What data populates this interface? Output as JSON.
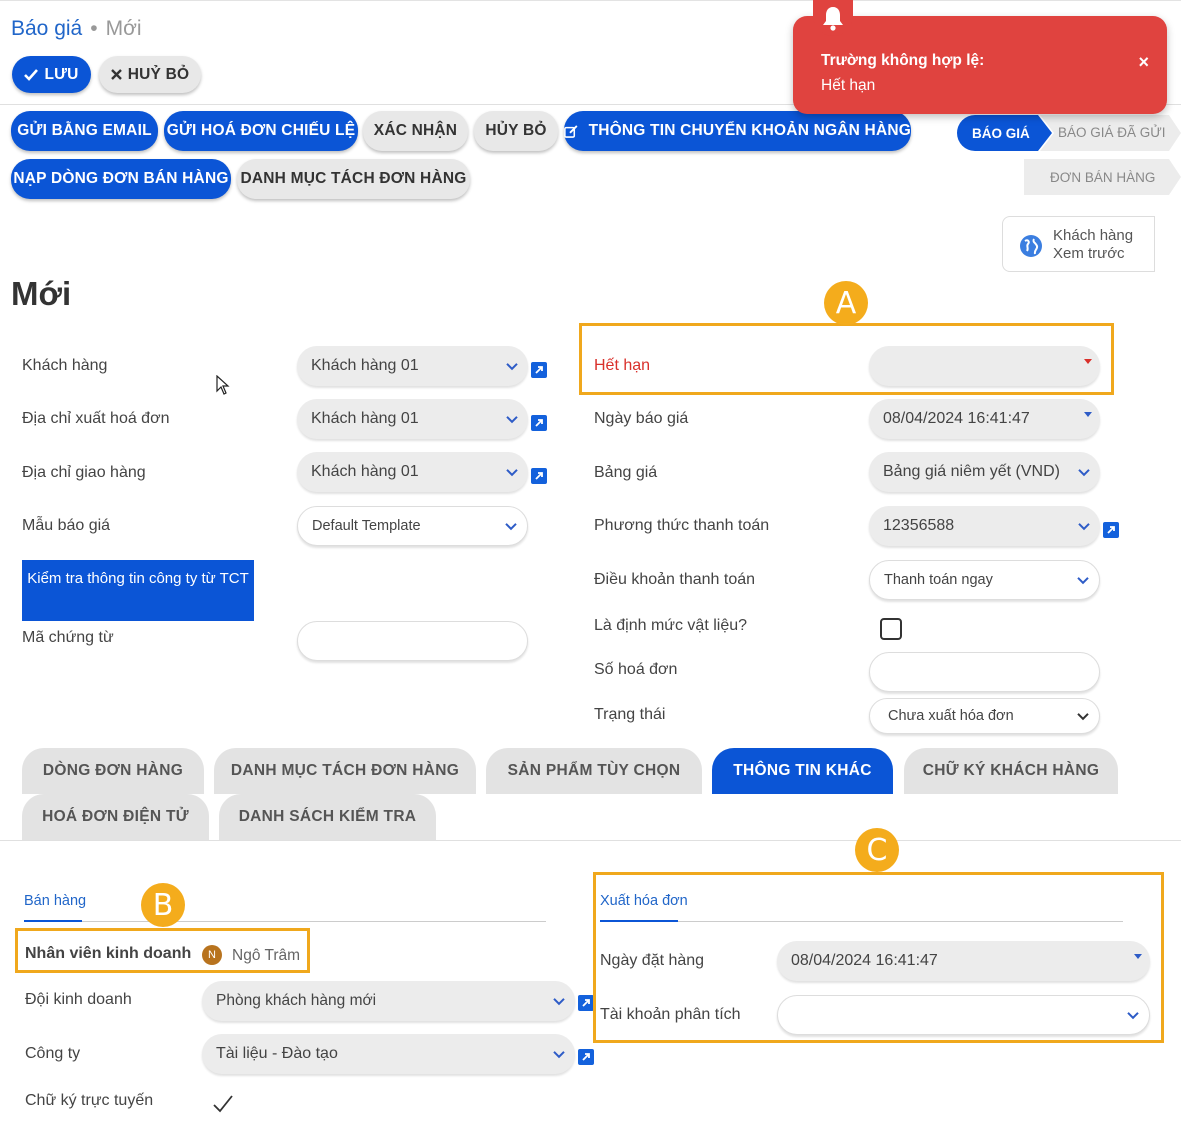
{
  "breadcrumb": {
    "parent": "Báo giá",
    "current": "Mới"
  },
  "toolbar": {
    "save_label": "LƯU",
    "discard_label": "HUỶ BỎ"
  },
  "actions": [
    "GỬI BẰNG EMAIL",
    "GỬI HOÁ ĐƠN CHIẾU LỆ",
    "XÁC NHẬN",
    "HỦY BỎ",
    "THÔNG TIN CHUYỂN KHOẢN NGÂN HÀNG",
    "NẠP DÒNG ĐƠN BÁN HÀNG",
    "DANH MỤC TÁCH ĐƠN HÀNG"
  ],
  "status_steps": [
    "BÁO GIÁ",
    "BÁO GIÁ ĐÃ GỬI",
    "ĐƠN BÁN HÀNG"
  ],
  "toast": {
    "title": "Trường không hợp lệ:",
    "message": "Hết hạn",
    "close": "×"
  },
  "preview": {
    "line1": "Khách hàng",
    "line2": "Xem trước"
  },
  "record_title": "Mới",
  "left_fields": {
    "customer": {
      "label": "Khách hàng",
      "value": "Khách hàng 01"
    },
    "invoice_address": {
      "label": "Địa chỉ xuất hoá đơn",
      "value": "Khách hàng 01"
    },
    "delivery_address": {
      "label": "Địa chỉ giao hàng",
      "value": "Khách hàng 01"
    },
    "template": {
      "label": "Mẫu báo giá",
      "value": "Default Template"
    },
    "check_button": "Kiểm tra thông tin công ty từ TCT",
    "doc_code": {
      "label": "Mã chứng từ",
      "value": ""
    }
  },
  "right_fields": {
    "expiry": {
      "label": "Hết hạn",
      "value": ""
    },
    "quote_date": {
      "label": "Ngày báo giá",
      "value": "08/04/2024 16:41:47"
    },
    "pricelist": {
      "label": "Bảng giá",
      "value": "Bảng giá niêm yết (VND)"
    },
    "payment_method": {
      "label": "Phương thức thanh toán",
      "value": "12356588"
    },
    "payment_terms": {
      "label": "Điều khoản thanh toán",
      "value": "Thanh toán ngay"
    },
    "material_norm": {
      "label": "Là định mức vật liệu?",
      "checked": false
    },
    "invoice_no": {
      "label": "Số hoá đơn",
      "value": ""
    },
    "status": {
      "label": "Trạng thái",
      "value": "Chưa xuất hóa đơn"
    }
  },
  "tabs": [
    "DÒNG ĐƠN HÀNG",
    "DANH MỤC TÁCH ĐƠN HÀNG",
    "SẢN PHẨM TÙY CHỌN",
    "THÔNG TIN KHÁC",
    "CHỮ KÝ KHÁCH HÀNG",
    "HOÁ ĐƠN ĐIỆN TỬ",
    "DANH SÁCH KIỂM TRA"
  ],
  "active_tab": "THÔNG TIN KHÁC",
  "sales": {
    "section": "Bán hàng",
    "salesperson": {
      "label": "Nhân viên kinh doanh",
      "value": "Ngô Trâm",
      "initial": "N"
    },
    "team": {
      "label": "Đội kinh doanh",
      "value": "Phòng khách hàng mới"
    },
    "company": {
      "label": "Công ty",
      "value": "Tài liệu - Đào tạo"
    },
    "online_signature": {
      "label": "Chữ ký trực tuyến",
      "checked": true
    }
  },
  "invoicing": {
    "section": "Xuất hóa đơn",
    "order_date": {
      "label": "Ngày đặt hàng",
      "value": "08/04/2024 16:41:47"
    },
    "analytic_account": {
      "label": "Tài khoản phân tích",
      "value": ""
    }
  },
  "annotations": [
    "A",
    "B",
    "C"
  ],
  "colors": {
    "primary": "#0b55d6",
    "danger": "#e0433f",
    "highlight": "#f0a81d"
  }
}
